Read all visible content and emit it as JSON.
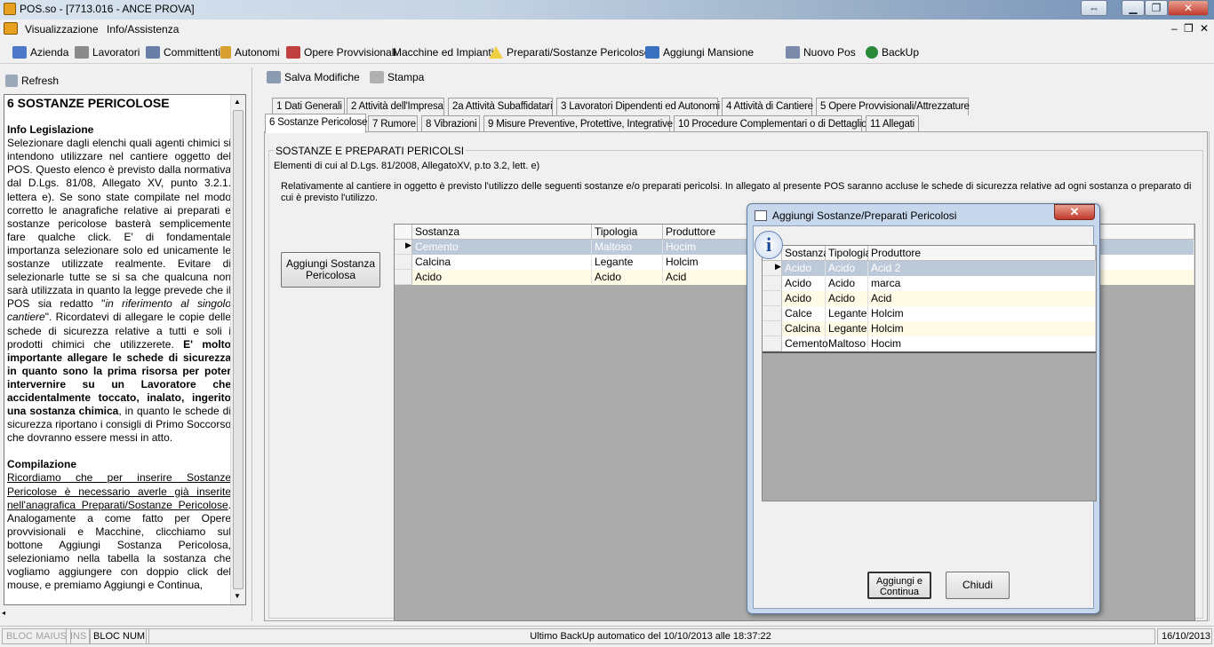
{
  "window": {
    "title": "POS.so - [7713.016 - ANCE PROVA]"
  },
  "menu": {
    "items": [
      "Visualizzazione",
      "Info/Assistenza"
    ]
  },
  "toolbar": {
    "items": [
      "Azienda",
      "Lavoratori",
      "Committenti",
      "Autonomi",
      "Opere Provvisionali",
      "Macchine ed Impianti",
      "Preparati/Sostanze Pericolose",
      "Aggiungi Mansione",
      "Nuovo Pos",
      "BackUp"
    ]
  },
  "left": {
    "refresh_label": "Refresh",
    "help_title": "6 SOSTANZE PERICOLOSE",
    "h_info": "Info Legislazione",
    "p1": "Selezionare dagli elenchi quali agenti chimici si intendono utilizzare nel cantiere oggetto del POS. Questo elenco è previsto dalla normativa dal D.Lgs. 81/08, Allegato XV, punto 3.2.1. lettera e). Se sono state compilate nel modo corretto le anagrafiche relative ai preparati e sostanze pericolose basterà semplicemente fare qualche click. E' di fondamentale importanza selezionare solo ed unicamente le sostanze utilizzate realmente. Evitare di selezionarle tutte se si sa che qualcuna non sarà utilizzata in quanto la legge prevede che il POS sia redatto \"",
    "p1_em": "in riferimento al singolo cantiere",
    "p1_b": "\". Ricordatevi di allegare le copie delle schede di sicurezza relative a tutti e soli i prodotti chimici che utilizzerete. ",
    "p1_strong": "E' molto importante allegare le schede di sicurezza in quanto sono la prima risorsa per poter intervernire su un Lavoratore che accidentalmente toccato, inalato, ingerito una sostanza chimica",
    "p1_end": ", in quanto le schede di sicurezza riportano i consigli di Primo Soccorso che dovranno essere messi in atto.",
    "h_comp": "Compilazione",
    "p2_u": "Ricordiamo che per inserire Sostanze Pericolose è necessario averle già inserite nell'anagrafica Preparati/Sostanze Pericolose",
    "p2": ". Analogamente a come fatto per Opere provvisionali e Macchine, clicchiamo sul bottone Aggiungi Sostanza Pericolosa, selezioniamo nella tabella la sostanza che vogliamo aggiungere con doppio click del mouse, e premiamo Aggiungi e Continua,"
  },
  "actions": {
    "save": "Salva Modifiche",
    "print": "Stampa"
  },
  "tabs_row1": [
    "1 Dati Generali",
    "2 Attività dell'Impresa",
    "2a Attività Subaffidatari",
    "3 Lavoratori Dipendenti ed Autonomi",
    "4 Attività di Cantiere",
    "5 Opere Provvisionali/Attrezzature"
  ],
  "tabs_row2": [
    "6 Sostanze Pericolose",
    "7 Rumore",
    "8 Vibrazioni",
    "9 Misure Preventive, Protettive, Integrative",
    "10 Procedure Complementari o di Dettaglio",
    "11 Allegati"
  ],
  "section": {
    "legend": "SOSTANZE E PREPARATI PERICOLSI",
    "subtitle": "Elementi di cui al D.Lgs. 81/2008, AllegatoXV, p.to 3.2, lett. e)",
    "description": "Relativamente al cantiere in oggetto è previsto l'utilizzo delle seguenti sostanze e/o preparati pericolsi. In allegato al presente POS saranno accluse le schede di sicurezza relative ad ogni sostanza o preparato di cui è previsto l'utilizzo.",
    "add_button": "Aggiungi Sostanza Pericolosa"
  },
  "main_table": {
    "columns": [
      "Sostanza",
      "Tipologia",
      "Produttore"
    ],
    "rows": [
      [
        "Cemento",
        "Maltoso",
        "Hocim"
      ],
      [
        "Calcina",
        "Legante",
        "Holcim"
      ],
      [
        "Acido",
        "Acido",
        "Acid"
      ]
    ]
  },
  "dialog": {
    "title": "Aggiungi Sostanze/Preparati Pericolosi",
    "close": "✕",
    "columns": [
      "Sostanza",
      "Tipologia",
      "Produttore"
    ],
    "rows": [
      [
        "Acido",
        "Acido",
        "Acid 2"
      ],
      [
        "Acido",
        "Acido",
        "marca"
      ],
      [
        "Acido",
        "Acido",
        "Acid"
      ],
      [
        "Calce",
        "Legante",
        "Holcim"
      ],
      [
        "Calcina",
        "Legante",
        "Holcim"
      ],
      [
        "Cemento",
        "Maltoso",
        "Hocim"
      ]
    ],
    "add_continue": "Aggiungi e Continua",
    "close_button": "Chiudi"
  },
  "status": {
    "caps": "BLOC MAIUS",
    "ins": "INS",
    "num": "BLOC NUM",
    "message": "Ultimo BackUp automatico del 10/10/2013 alle 18:37:22",
    "date": "16/10/2013"
  }
}
